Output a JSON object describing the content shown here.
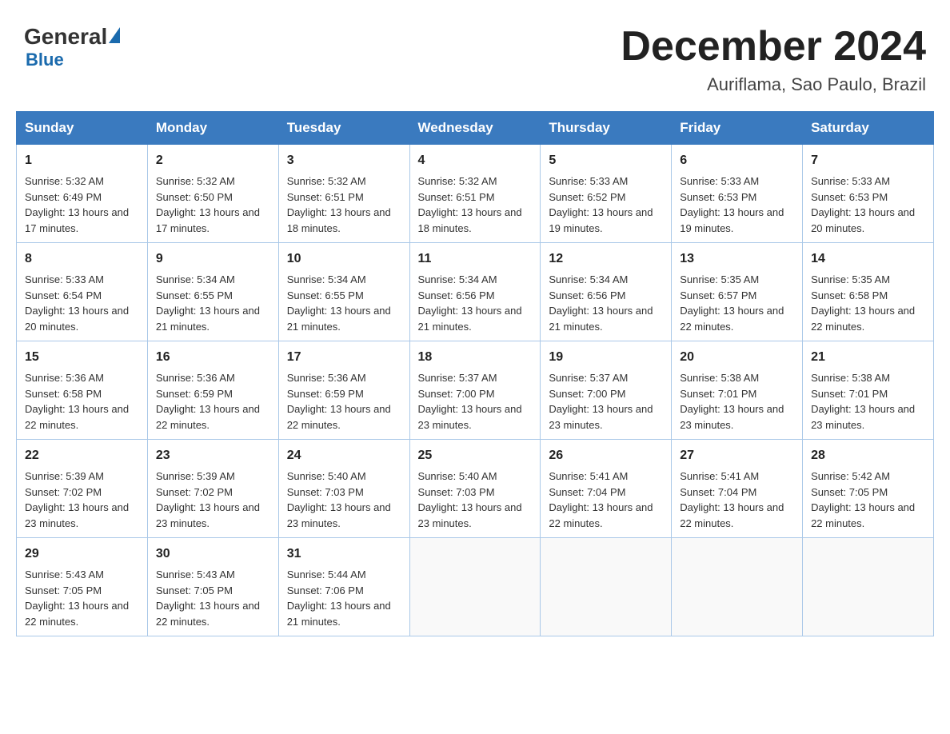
{
  "header": {
    "logo_general": "General",
    "logo_blue": "Blue",
    "month_title": "December 2024",
    "location": "Auriflama, Sao Paulo, Brazil"
  },
  "days_of_week": [
    "Sunday",
    "Monday",
    "Tuesday",
    "Wednesday",
    "Thursday",
    "Friday",
    "Saturday"
  ],
  "weeks": [
    [
      {
        "day": "1",
        "sunrise": "Sunrise: 5:32 AM",
        "sunset": "Sunset: 6:49 PM",
        "daylight": "Daylight: 13 hours and 17 minutes."
      },
      {
        "day": "2",
        "sunrise": "Sunrise: 5:32 AM",
        "sunset": "Sunset: 6:50 PM",
        "daylight": "Daylight: 13 hours and 17 minutes."
      },
      {
        "day": "3",
        "sunrise": "Sunrise: 5:32 AM",
        "sunset": "Sunset: 6:51 PM",
        "daylight": "Daylight: 13 hours and 18 minutes."
      },
      {
        "day": "4",
        "sunrise": "Sunrise: 5:32 AM",
        "sunset": "Sunset: 6:51 PM",
        "daylight": "Daylight: 13 hours and 18 minutes."
      },
      {
        "day": "5",
        "sunrise": "Sunrise: 5:33 AM",
        "sunset": "Sunset: 6:52 PM",
        "daylight": "Daylight: 13 hours and 19 minutes."
      },
      {
        "day": "6",
        "sunrise": "Sunrise: 5:33 AM",
        "sunset": "Sunset: 6:53 PM",
        "daylight": "Daylight: 13 hours and 19 minutes."
      },
      {
        "day": "7",
        "sunrise": "Sunrise: 5:33 AM",
        "sunset": "Sunset: 6:53 PM",
        "daylight": "Daylight: 13 hours and 20 minutes."
      }
    ],
    [
      {
        "day": "8",
        "sunrise": "Sunrise: 5:33 AM",
        "sunset": "Sunset: 6:54 PM",
        "daylight": "Daylight: 13 hours and 20 minutes."
      },
      {
        "day": "9",
        "sunrise": "Sunrise: 5:34 AM",
        "sunset": "Sunset: 6:55 PM",
        "daylight": "Daylight: 13 hours and 21 minutes."
      },
      {
        "day": "10",
        "sunrise": "Sunrise: 5:34 AM",
        "sunset": "Sunset: 6:55 PM",
        "daylight": "Daylight: 13 hours and 21 minutes."
      },
      {
        "day": "11",
        "sunrise": "Sunrise: 5:34 AM",
        "sunset": "Sunset: 6:56 PM",
        "daylight": "Daylight: 13 hours and 21 minutes."
      },
      {
        "day": "12",
        "sunrise": "Sunrise: 5:34 AM",
        "sunset": "Sunset: 6:56 PM",
        "daylight": "Daylight: 13 hours and 21 minutes."
      },
      {
        "day": "13",
        "sunrise": "Sunrise: 5:35 AM",
        "sunset": "Sunset: 6:57 PM",
        "daylight": "Daylight: 13 hours and 22 minutes."
      },
      {
        "day": "14",
        "sunrise": "Sunrise: 5:35 AM",
        "sunset": "Sunset: 6:58 PM",
        "daylight": "Daylight: 13 hours and 22 minutes."
      }
    ],
    [
      {
        "day": "15",
        "sunrise": "Sunrise: 5:36 AM",
        "sunset": "Sunset: 6:58 PM",
        "daylight": "Daylight: 13 hours and 22 minutes."
      },
      {
        "day": "16",
        "sunrise": "Sunrise: 5:36 AM",
        "sunset": "Sunset: 6:59 PM",
        "daylight": "Daylight: 13 hours and 22 minutes."
      },
      {
        "day": "17",
        "sunrise": "Sunrise: 5:36 AM",
        "sunset": "Sunset: 6:59 PM",
        "daylight": "Daylight: 13 hours and 22 minutes."
      },
      {
        "day": "18",
        "sunrise": "Sunrise: 5:37 AM",
        "sunset": "Sunset: 7:00 PM",
        "daylight": "Daylight: 13 hours and 23 minutes."
      },
      {
        "day": "19",
        "sunrise": "Sunrise: 5:37 AM",
        "sunset": "Sunset: 7:00 PM",
        "daylight": "Daylight: 13 hours and 23 minutes."
      },
      {
        "day": "20",
        "sunrise": "Sunrise: 5:38 AM",
        "sunset": "Sunset: 7:01 PM",
        "daylight": "Daylight: 13 hours and 23 minutes."
      },
      {
        "day": "21",
        "sunrise": "Sunrise: 5:38 AM",
        "sunset": "Sunset: 7:01 PM",
        "daylight": "Daylight: 13 hours and 23 minutes."
      }
    ],
    [
      {
        "day": "22",
        "sunrise": "Sunrise: 5:39 AM",
        "sunset": "Sunset: 7:02 PM",
        "daylight": "Daylight: 13 hours and 23 minutes."
      },
      {
        "day": "23",
        "sunrise": "Sunrise: 5:39 AM",
        "sunset": "Sunset: 7:02 PM",
        "daylight": "Daylight: 13 hours and 23 minutes."
      },
      {
        "day": "24",
        "sunrise": "Sunrise: 5:40 AM",
        "sunset": "Sunset: 7:03 PM",
        "daylight": "Daylight: 13 hours and 23 minutes."
      },
      {
        "day": "25",
        "sunrise": "Sunrise: 5:40 AM",
        "sunset": "Sunset: 7:03 PM",
        "daylight": "Daylight: 13 hours and 23 minutes."
      },
      {
        "day": "26",
        "sunrise": "Sunrise: 5:41 AM",
        "sunset": "Sunset: 7:04 PM",
        "daylight": "Daylight: 13 hours and 22 minutes."
      },
      {
        "day": "27",
        "sunrise": "Sunrise: 5:41 AM",
        "sunset": "Sunset: 7:04 PM",
        "daylight": "Daylight: 13 hours and 22 minutes."
      },
      {
        "day": "28",
        "sunrise": "Sunrise: 5:42 AM",
        "sunset": "Sunset: 7:05 PM",
        "daylight": "Daylight: 13 hours and 22 minutes."
      }
    ],
    [
      {
        "day": "29",
        "sunrise": "Sunrise: 5:43 AM",
        "sunset": "Sunset: 7:05 PM",
        "daylight": "Daylight: 13 hours and 22 minutes."
      },
      {
        "day": "30",
        "sunrise": "Sunrise: 5:43 AM",
        "sunset": "Sunset: 7:05 PM",
        "daylight": "Daylight: 13 hours and 22 minutes."
      },
      {
        "day": "31",
        "sunrise": "Sunrise: 5:44 AM",
        "sunset": "Sunset: 7:06 PM",
        "daylight": "Daylight: 13 hours and 21 minutes."
      },
      null,
      null,
      null,
      null
    ]
  ]
}
